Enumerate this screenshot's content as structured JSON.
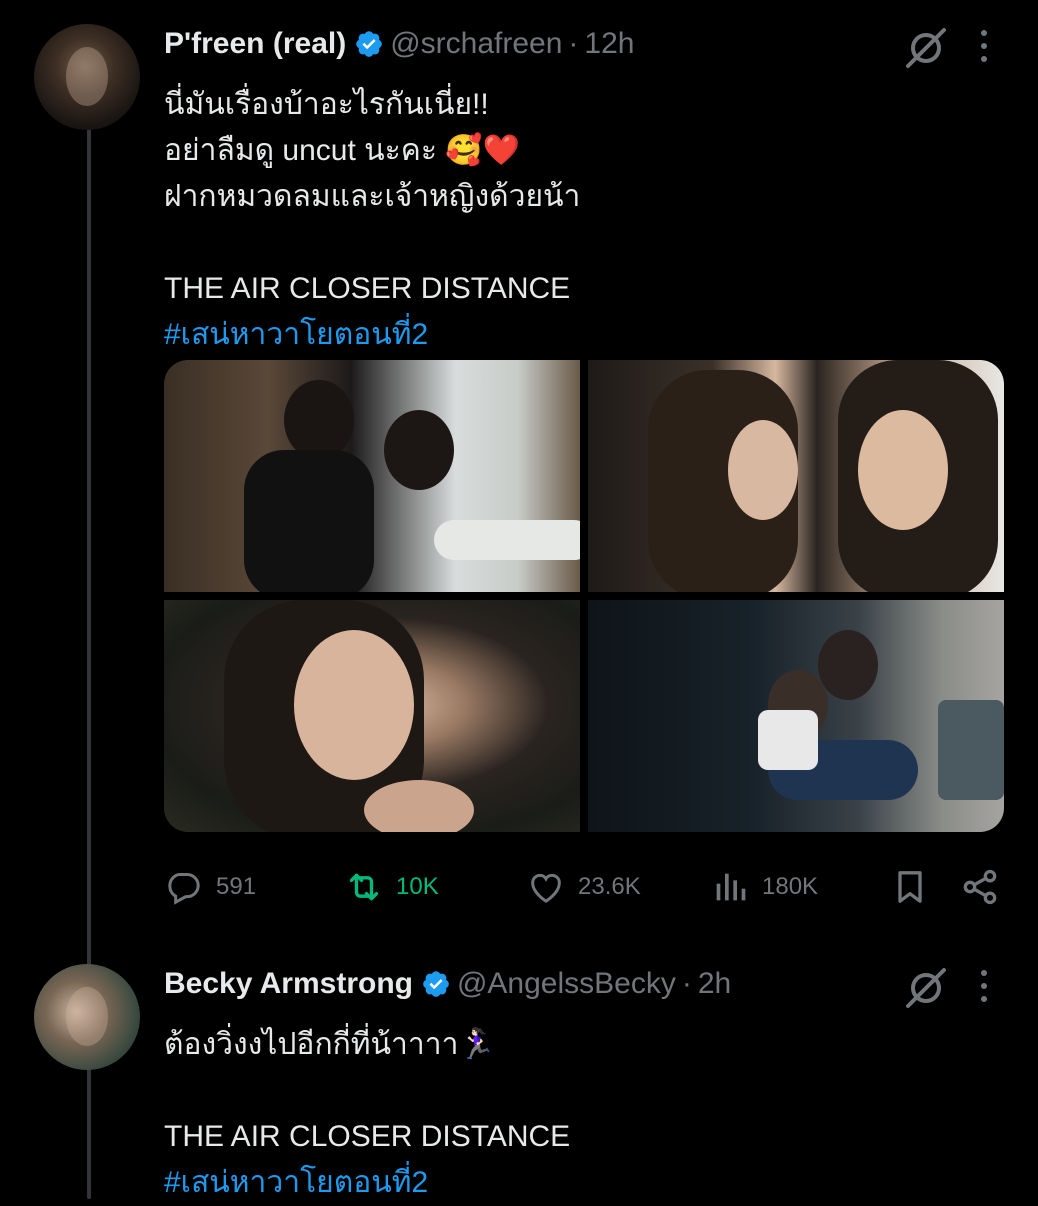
{
  "tweets": [
    {
      "display_name": "P'freen (real)",
      "handle": "@srchafreen",
      "separator": "·",
      "time": "12h",
      "lines": [
        "นี่มันเรื่องบ้าอะไรกันเนี่ย!!",
        "อย่าลืมดู uncut นะคะ 🥰❤️",
        "ฝากหมวดลมและเจ้าหญิงด้วยน้า",
        "",
        "THE AIR CLOSER DISTANCE"
      ],
      "hashtag": "#เสน่หาวาโยตอนที่2",
      "stats": {
        "replies": "591",
        "retweets": "10K",
        "likes": "23.6K",
        "views": "180K"
      }
    },
    {
      "display_name": "Becky Armstrong",
      "handle": "@AngelssBecky",
      "separator": "·",
      "time": "2h",
      "lines": [
        "ต้องวิ่งงไปอีกกี่ที่น้าาาา🏃🏻‍♀️",
        "",
        "THE AIR CLOSER DISTANCE"
      ],
      "hashtag": "#เสน่หาวาโยตอนที่2"
    }
  ],
  "colors": {
    "background": "#000000",
    "text": "#e7e9ea",
    "muted": "#71767b",
    "link": "#1d9bf0",
    "retweet_active": "#00ba7c",
    "verified": "#1d9bf0"
  },
  "icons": [
    "verified-badge-icon",
    "grok-icon",
    "more-icon",
    "reply-icon",
    "retweet-icon",
    "like-icon",
    "views-icon",
    "bookmark-icon",
    "share-icon"
  ]
}
